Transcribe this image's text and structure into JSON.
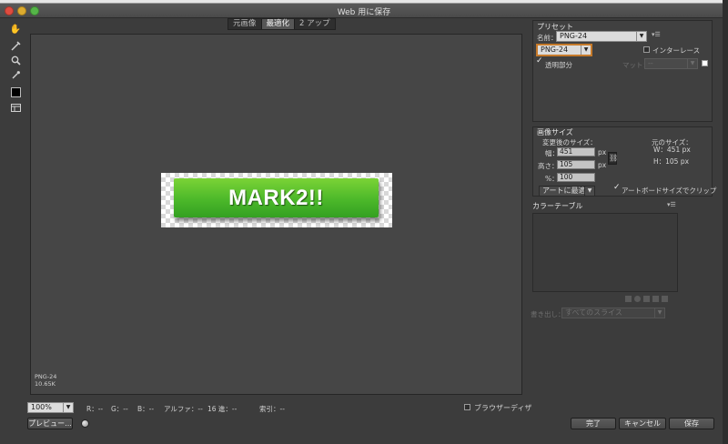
{
  "window": {
    "title": "Web 用に保存"
  },
  "toolbar": {
    "tools": [
      "hand-tool",
      "slice-select-tool",
      "zoom-tool",
      "eyedropper-tool",
      "eyedropper-color",
      "toggle-slices"
    ]
  },
  "tabs": [
    {
      "label": "元画像",
      "active": false
    },
    {
      "label": "最適化",
      "active": true
    },
    {
      "label": "2 アップ",
      "active": false
    }
  ],
  "preview": {
    "button_text": "MARK2!!",
    "info_format": "PNG-24",
    "info_size": "10.65K"
  },
  "status": {
    "zoom": "100%",
    "r": "R：--",
    "g": "G：--",
    "b": "B：--",
    "alpha": "アルファ：--",
    "hex": "16 進：--",
    "index": "索引：--",
    "browser_dither": "ブラウザーディザ"
  },
  "bottom_buttons": {
    "preview": "プレビュー...",
    "done": "完了",
    "cancel": "キャンセル",
    "save": "保存"
  },
  "preset": {
    "title": "プリセット",
    "name_label": "名前：",
    "name_value": "PNG-24",
    "format_value": "PNG-24",
    "interlace": "インターレース",
    "transparency": "透明部分",
    "matte_label": "マット：",
    "matte_value": "--"
  },
  "image_size": {
    "title": "画像サイズ",
    "new_size_label": "変更後のサイズ：",
    "original_size_label": "元のサイズ：",
    "width_label": "幅：",
    "width_value": "451",
    "height_label": "高さ：",
    "height_value": "105",
    "percent_label": "%：",
    "percent_value": "100",
    "unit": "px",
    "original_w": "W：451 px",
    "original_h": "H：105 px",
    "fit_option": "アートに最適",
    "clip_to_artboard": "アートボードサイズでクリップ"
  },
  "color_table": {
    "title": "カラーテーブル"
  },
  "export": {
    "label": "書き出し：",
    "value": "すべてのスライス"
  },
  "colors": {
    "accent_green": "#4cb82a",
    "window_bg": "#3c3c3c",
    "canvas_bg": "#464646"
  }
}
